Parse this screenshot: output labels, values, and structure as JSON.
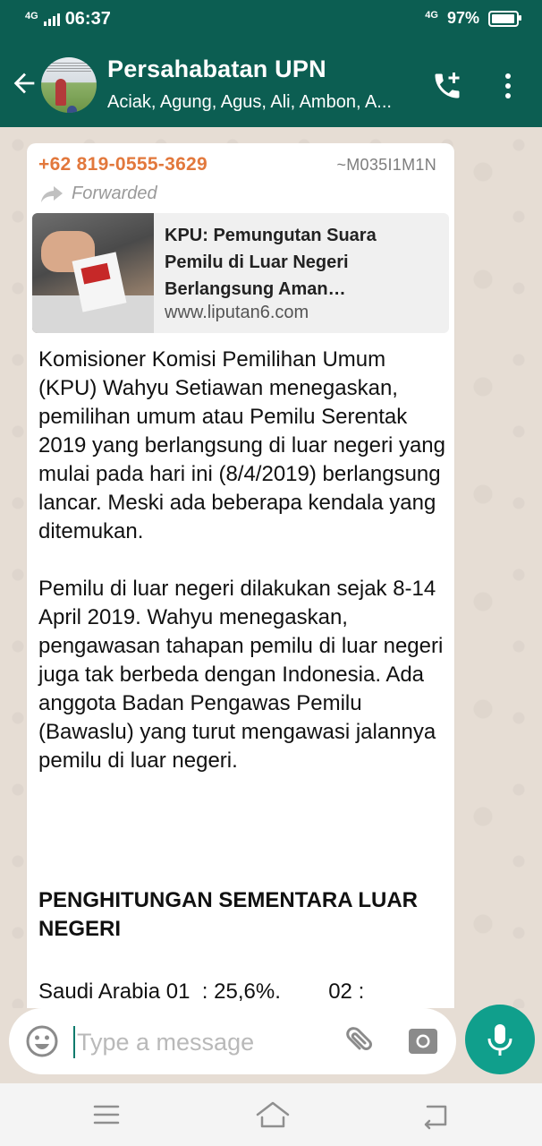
{
  "status_bar": {
    "network_left": "4G",
    "time": "06:37",
    "network_right": "4G",
    "battery": "97%",
    "battery_level": 0.97
  },
  "header": {
    "title": "Persahabatan UPN",
    "subtitle": "Aciak, Agung, Agus, Ali, Ambon, A..."
  },
  "message": {
    "sender": "+62 819-0555-3629",
    "pushname": "~M035I1M1N",
    "forwarded_label": "Forwarded",
    "link_preview": {
      "title": "KPU: Pemungutan Suara Pemilu di Luar Negeri Berlangsung Aman…",
      "domain": "www.liputan6.com"
    },
    "paragraph1": "Komisioner Komisi Pemilihan Umum (KPU) Wahyu Setiawan menegaskan, pemilihan umum atau Pemilu Serentak 2019 yang berlangsung di luar negeri yang mulai pada hari ini (8/4/2019) berlangsung lancar. Meski ada beberapa kendala yang ditemukan.",
    "paragraph2": "Pemilu di luar negeri dilakukan sejak 8-14 April 2019. Wahyu menegaskan, pengawasan tahapan pemilu di luar negeri juga tak berbeda dengan Indonesia. Ada anggota Badan Pengawas Pemilu (Bawaslu) yang turut mengawasi jalannya pemilu di luar negeri.",
    "heading": "PENGHITUNGAN SEMENTARA LUAR NEGERI",
    "last_line": "Saudi Arabia 01  : 25,6%.        02 :"
  },
  "input": {
    "placeholder": "Type a message"
  },
  "icons": {
    "back": "arrow-left-icon",
    "call": "add-call-icon",
    "menu": "more-vert-icon",
    "forward": "forward-icon",
    "scroll": "double-chevron-down-icon",
    "emoji": "emoji-icon",
    "attach": "paperclip-icon",
    "camera": "camera-icon",
    "mic": "microphone-icon",
    "nav_menu": "hamburger-icon",
    "nav_home": "home-icon",
    "nav_back": "back-nav-icon"
  },
  "colors": {
    "header": "#0c5e52",
    "accent": "#109f8c",
    "sender": "#e2783c"
  }
}
